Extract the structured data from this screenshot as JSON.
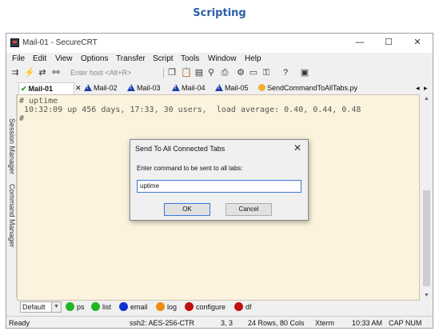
{
  "heading": "Scripting",
  "window": {
    "title": "Mail-01 - SecureCRT",
    "minimize": "—",
    "maximize": "☐",
    "close": "✕"
  },
  "menu": [
    "File",
    "Edit",
    "View",
    "Options",
    "Transfer",
    "Script",
    "Tools",
    "Window",
    "Help"
  ],
  "toolbar": {
    "host_placeholder": "Enter host <Alt+R>"
  },
  "tabs": [
    {
      "label": "Mail-01",
      "status": "connected"
    },
    {
      "label": "Mail-02",
      "status": "warning"
    },
    {
      "label": "Mail-03",
      "status": "warning"
    },
    {
      "label": "Mail-04",
      "status": "warning"
    },
    {
      "label": "Mail-05",
      "status": "warning"
    },
    {
      "label": "SendCommandToAllTabs.py",
      "status": "script"
    }
  ],
  "tab_close": "✕",
  "side_panels": [
    "Session Manager",
    "Command Manager"
  ],
  "terminal": {
    "lines": [
      "# uptime",
      " 10:32:09 up 456 days, 17:33, 30 users,  load average: 0.40, 0.44, 0.48",
      "#"
    ]
  },
  "dialog": {
    "title": "Send To All Connected Tabs",
    "close": "✕",
    "prompt": "Enter command to be sent to all tabs:",
    "input_value": "uptime",
    "ok_label": "OK",
    "cancel_label": "Cancel"
  },
  "button_bar": {
    "selected": "Default",
    "buttons": [
      {
        "label": "ps",
        "color": "#22b522"
      },
      {
        "label": "list",
        "color": "#22b522"
      },
      {
        "label": "email",
        "color": "#1030d0"
      },
      {
        "label": "log",
        "color": "#f08a10"
      },
      {
        "label": "configure",
        "color": "#c01010"
      },
      {
        "label": "df",
        "color": "#c01010"
      }
    ]
  },
  "status": {
    "ready": "Ready",
    "cipher": "ssh2: AES-256-CTR",
    "cursor": "3,  3",
    "size": "24 Rows, 80 Cols",
    "terminal": "Xterm",
    "time": "10:33 AM",
    "caps": "CAP NUM"
  }
}
